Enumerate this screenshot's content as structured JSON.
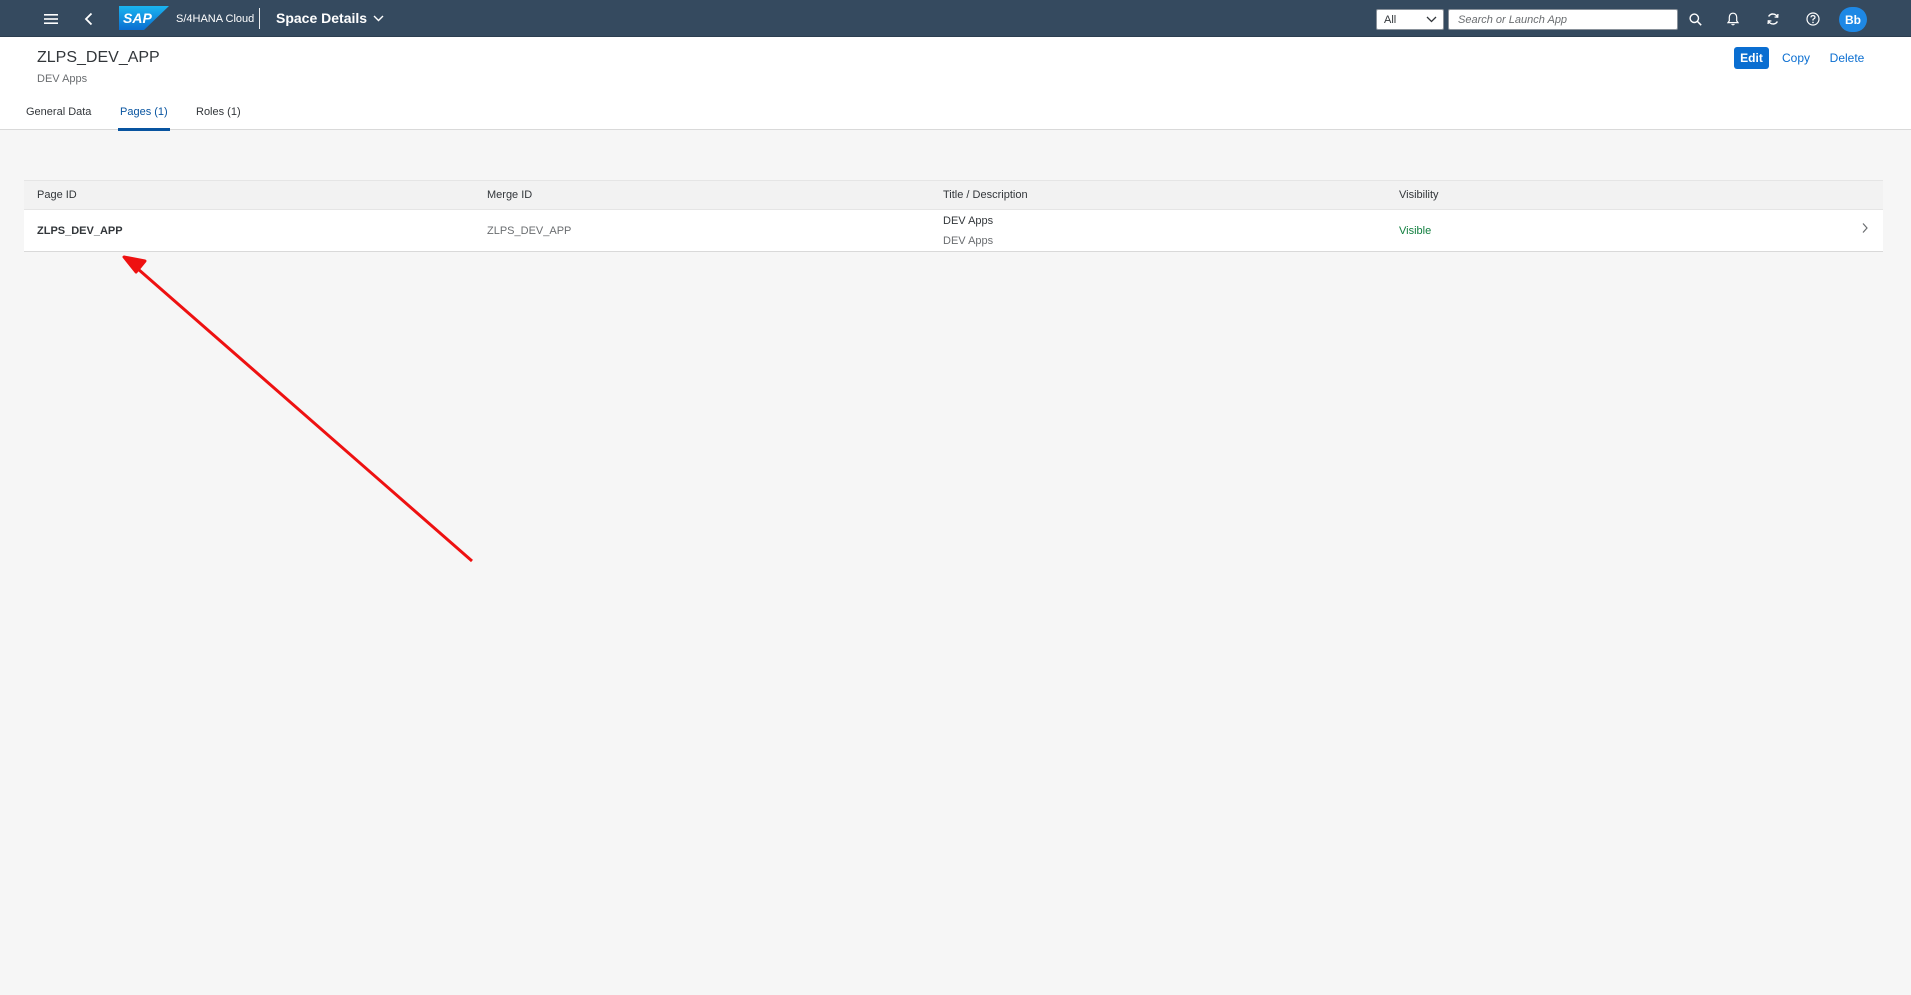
{
  "shell": {
    "product_name": "S/4HANA Cloud",
    "app_title": "Space Details",
    "scope_select": "All",
    "search_placeholder": "Search or Launch App",
    "avatar_initials": "Bb",
    "logo_text": "SAP"
  },
  "header": {
    "title": "ZLPS_DEV_APP",
    "subtitle": "DEV Apps",
    "actions": {
      "edit": "Edit",
      "copy": "Copy",
      "delete": "Delete"
    }
  },
  "tabs": [
    {
      "label": "General Data",
      "active": false
    },
    {
      "label": "Pages (1)",
      "active": true
    },
    {
      "label": "Roles (1)",
      "active": false
    }
  ],
  "table": {
    "columns": [
      "Page ID",
      "Merge ID",
      "Title / Description",
      "Visibility"
    ],
    "rows": [
      {
        "page_id": "ZLPS_DEV_APP",
        "merge_id": "ZLPS_DEV_APP",
        "title": "DEV Apps",
        "description": "DEV Apps",
        "visibility": "Visible"
      }
    ]
  },
  "colors": {
    "shell_bg": "#354a5f",
    "accent": "#0a6ed1",
    "positive": "#107e3e",
    "annotation_arrow": "#ee1111"
  }
}
